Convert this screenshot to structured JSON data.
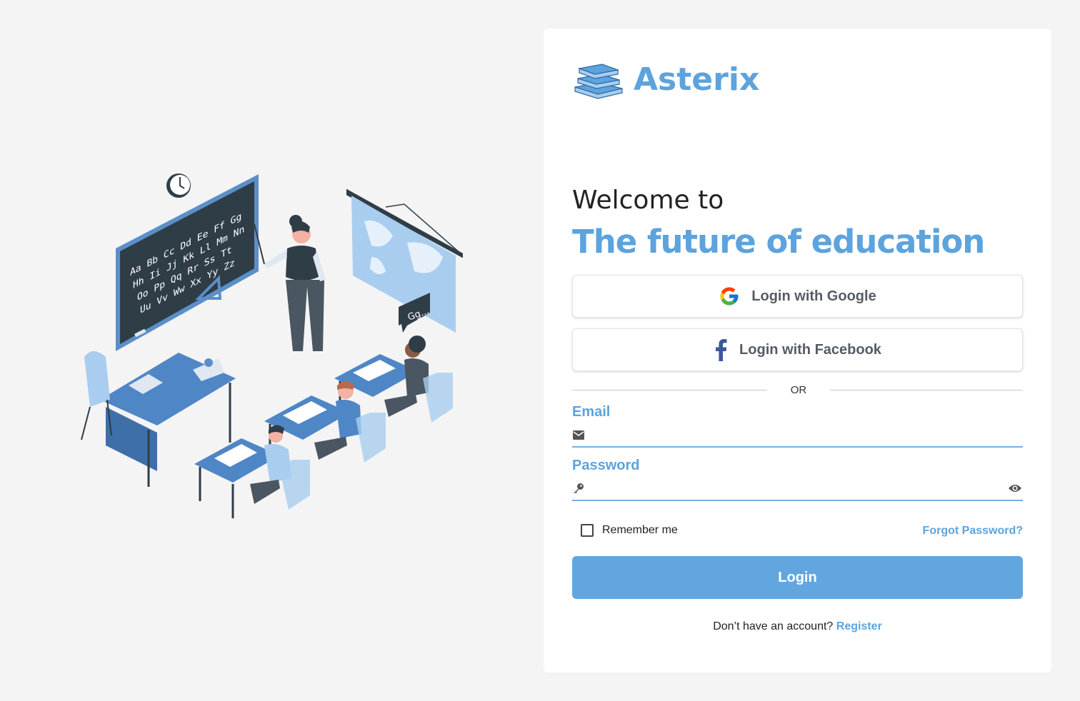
{
  "brand": {
    "name": "Asterix",
    "logo_icon": "stacked-books-icon",
    "accent_color": "#5da3dd"
  },
  "illustration": {
    "name": "classroom-illustration",
    "blackboard_text": [
      "Aa Bb Cc Dd Ee Ff Gg",
      "Hh Ii Jj Kk Ll Mm Nn",
      "Oo Pp Qq Rr Ss Tt",
      "Uu Vv Ww Xx Yy Zz"
    ],
    "speech_bubble": "Gg..."
  },
  "welcome": {
    "line1": "Welcome to",
    "headline": "The future of education"
  },
  "social": {
    "google_label": "Login with Google",
    "facebook_label": "Login with Facebook"
  },
  "divider": {
    "text": "OR"
  },
  "form": {
    "email_label": "Email",
    "email_value": "",
    "password_label": "Password",
    "password_value": "",
    "remember_label": "Remember me",
    "remember_checked": false,
    "forgot_label": "Forgot Password?",
    "login_label": "Login",
    "button_color": "#62a6e0"
  },
  "footer": {
    "prompt": "Don’t have an account?",
    "register_label": "Register"
  }
}
